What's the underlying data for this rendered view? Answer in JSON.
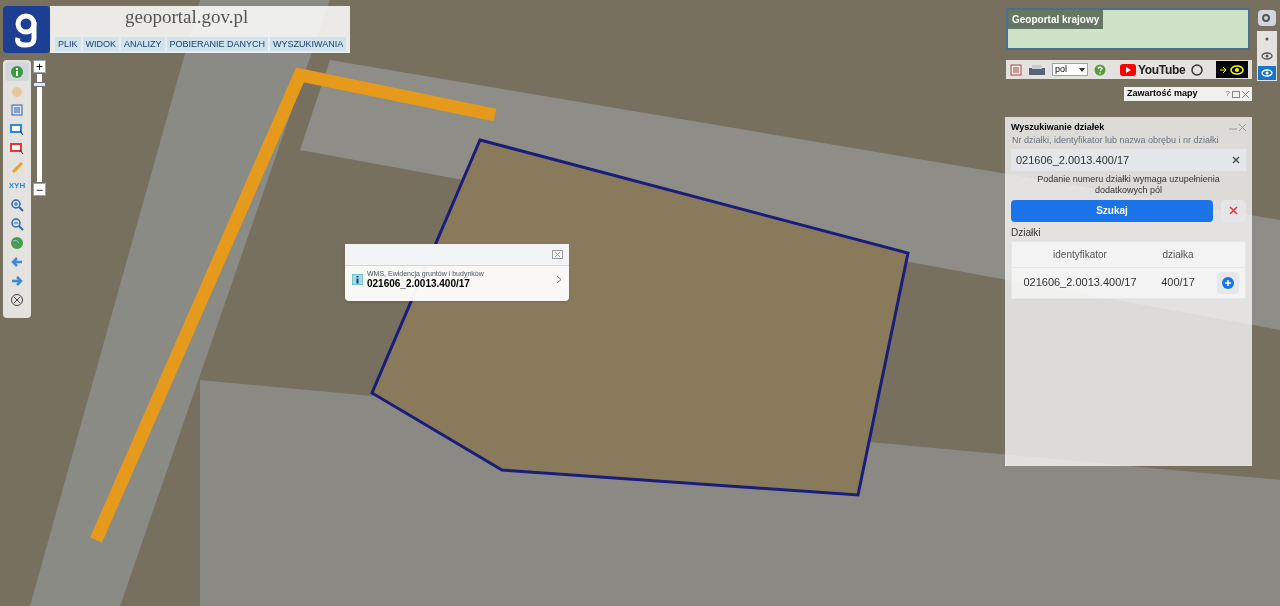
{
  "header": {
    "site_title": "geoportal.gov.pl",
    "menu": [
      {
        "label": "PLIK"
      },
      {
        "label": "WIDOK"
      },
      {
        "label": "ANALIZY"
      },
      {
        "label": "POBIERANIE DANYCH"
      },
      {
        "label": "WYSZUKIWANIA"
      }
    ]
  },
  "zoom": {
    "plus": "+",
    "minus": "−",
    "level": 0.92
  },
  "toolbar": [
    {
      "kind": "info",
      "selected": true
    },
    {
      "kind": "pan",
      "selected": false
    },
    {
      "kind": "legend",
      "selected": false
    },
    {
      "kind": "select",
      "selected": false
    },
    {
      "kind": "select-red",
      "selected": false
    },
    {
      "kind": "pencil",
      "selected": false
    },
    {
      "kind": "xyz",
      "label": "XYH",
      "selected": false
    },
    {
      "kind": "zoom-in",
      "selected": false
    },
    {
      "kind": "zoom-out",
      "selected": false
    },
    {
      "kind": "globe",
      "selected": false
    },
    {
      "kind": "back",
      "selected": false
    },
    {
      "kind": "forward",
      "selected": false
    },
    {
      "kind": "clear",
      "selected": false
    }
  ],
  "overview": {
    "title": "Geoportal krajowy"
  },
  "top_tools": {
    "language": "pol",
    "youtube": "YouTube",
    "contrast_selected": false
  },
  "side_buttons": [
    {
      "kind": "dot",
      "selected": false
    },
    {
      "kind": "eye",
      "selected": false
    },
    {
      "kind": "eye",
      "selected": true
    }
  ],
  "map_content_panel": {
    "title": "Zawartość mapy",
    "help": "?"
  },
  "popup": {
    "source": "WMS, Ewidencja gruntów i budynków",
    "parcel_id": "021606_2.0013.400/17"
  },
  "search_panel": {
    "title": "Wyszukiwanie działek",
    "placeholder": "Nr działki, identyfikator lub nazwa obrębu i nr działki",
    "value": "021606_2.0013.400/17",
    "note": "Podanie numeru działki wymaga uzupełnienia dodatkowych pól",
    "search_button": "Szukaj",
    "results_label": "Działki",
    "columns": [
      "identyfikator",
      "działka"
    ],
    "rows": [
      {
        "identifier": "021606_2.0013.400/17",
        "parcel": "400/17"
      }
    ]
  }
}
